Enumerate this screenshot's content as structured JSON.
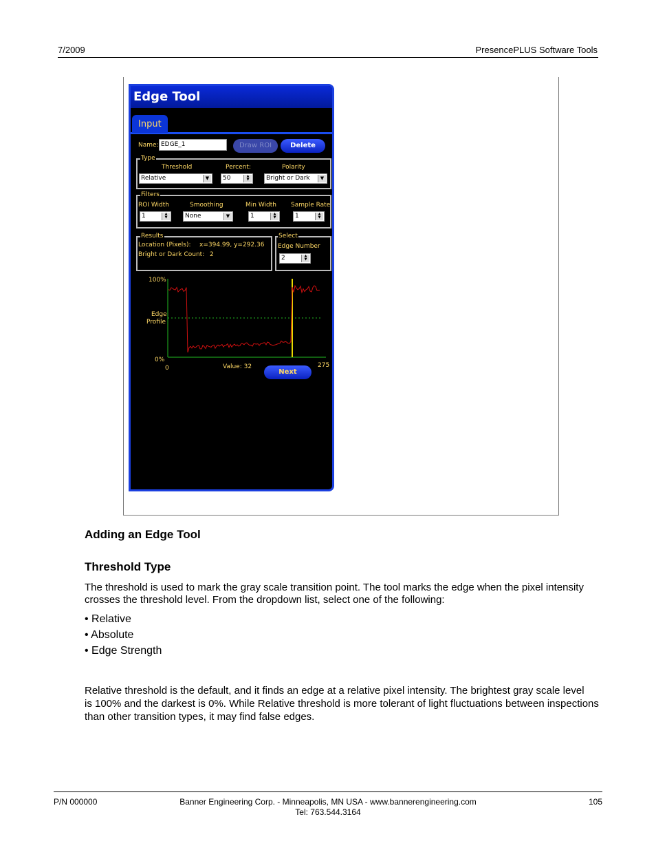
{
  "header": {
    "date": "7/2009",
    "title": "PresencePLUS Software Tools"
  },
  "app": {
    "title": "Edge Tool",
    "tab": "Input",
    "name_label": "Name:",
    "name_value": "EDGE_1",
    "draw_roi": "Draw ROI",
    "delete": "Delete",
    "type_group": "Type",
    "threshold_label": "Threshold",
    "threshold_value": "Relative",
    "percent_label": "Percent:",
    "percent_value": "50",
    "polarity_label": "Polarity",
    "polarity_value": "Bright or Dark",
    "filters_group": "Filters",
    "roi_width_label": "ROI Width",
    "roi_width_value": "1",
    "smoothing_label": "Smoothing",
    "smoothing_value": "None",
    "min_width_label": "Min Width",
    "min_width_value": "1",
    "sample_rate_label": "Sample Rate",
    "sample_rate_value": "1",
    "results_group": "Results",
    "location_label": "Location (Pixels):",
    "location_value": "x=394.99, y=292.36",
    "count_label": "Bright or Dark Count:",
    "count_value": "2",
    "select_group": "Select",
    "edge_number_label": "Edge Number",
    "edge_number_value": "2",
    "plot": {
      "y_top": "100%",
      "y_bottom": "0%",
      "edge_label_1": "Edge",
      "edge_label_2": "Profile",
      "x_start": "0",
      "x_end": "275",
      "value_text": "Value: 32",
      "colors": {
        "profile": "#d01010",
        "threshold": "#22bb22",
        "axis": "#22bb22",
        "marker": "#e8d800"
      }
    },
    "next": "Next"
  },
  "doc": {
    "heading1": "Adding an Edge Tool",
    "heading2": "Threshold Type",
    "para1_line1": "The threshold is used to mark the gray scale transition point. The tool marks the edge when the pixel intensity",
    "para1_line2": "crosses the threshold level. From the dropdown list, select one of the following:",
    "bullets": [
      "• Relative",
      "• Absolute",
      "• Edge Strength"
    ],
    "para2_line1": "Relative threshold  is the default, and it finds an edge at a relative pixel intensity. The brightest gray scale level",
    "para2_line2": "is 100% and the darkest is 0%. While Relative threshold is more tolerant of light fluctuations between inspections",
    "para2_line3": "than other transition types, it may find false edges."
  },
  "footer": {
    "part": "P/N 000000",
    "company": "Banner Engineering Corp. - Minneapolis, MN USA - www.bannerengineering.com",
    "tel": "Tel: 763.544.3164",
    "page": "105"
  }
}
